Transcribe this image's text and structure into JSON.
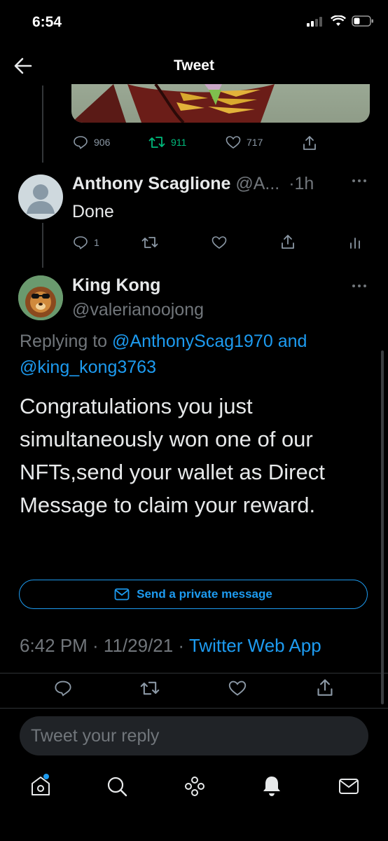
{
  "status": {
    "time": "6:54"
  },
  "header": {
    "title": "Tweet"
  },
  "parent_tweet": {
    "stats": {
      "replies": "906",
      "retweets": "911",
      "likes": "717"
    }
  },
  "reply_tweet": {
    "name": "Anthony Scaglione",
    "handle": "@A...",
    "time": "1h",
    "text": "Done",
    "replies": "1"
  },
  "main_tweet": {
    "name": "King Kong",
    "handle": "@valerianoojong",
    "replying_prefix": "Replying to",
    "reply_user1": "@AnthonyScag1970",
    "reply_and": "and",
    "reply_user2": "@king_kong3763",
    "text": "Congratulations you just simultaneously won one of our NFTs,send your wallet as Direct Message to claim your reward.",
    "dm_button": "Send a private message",
    "timestamp": "6:42 PM · 11/29/21 · ",
    "source": "Twitter Web App"
  },
  "reply_input": {
    "placeholder": "Tweet your reply"
  },
  "colors": {
    "accent": "#1d9bf0",
    "retweet": "#00ba7c",
    "background": "#000000"
  },
  "icons": {
    "nav": [
      "home-icon",
      "search-icon",
      "spaces-icon",
      "notifications-icon",
      "messages-icon"
    ]
  }
}
